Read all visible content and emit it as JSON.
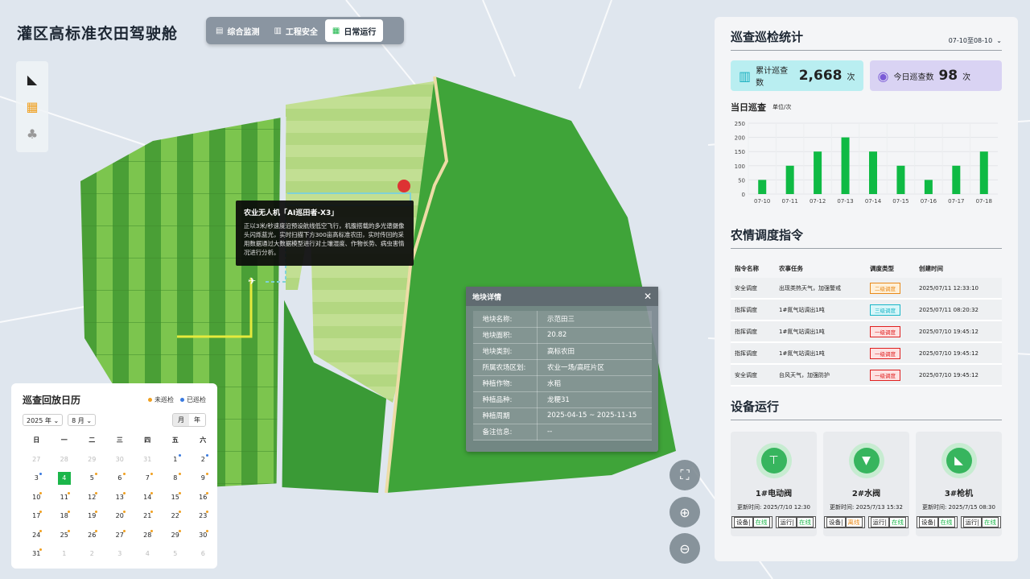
{
  "header": {
    "title": "灌区高标准农田驾驶舱"
  },
  "nav": {
    "tabs": [
      {
        "label": "综合监测",
        "icon": "monitor-icon"
      },
      {
        "label": "工程安全",
        "icon": "building-icon"
      },
      {
        "label": "日常运行",
        "icon": "operation-icon",
        "active": true
      }
    ]
  },
  "toolbox": {
    "icons": [
      "camera-icon",
      "field-icon",
      "crop-icon"
    ]
  },
  "popup": {
    "title": "农业无人机「AI巡田者-X3」",
    "text": "正以3米/秒速度沿预设航线低空飞行，机腹搭载的多光谱摄像头闪烁蓝光，实时扫描下方300亩高标准农田，实时传回的采用数据通过大数据模型进行对土壤湿度、作物长势、病虫害情况进行分析。"
  },
  "plot": {
    "title": "地块详情",
    "rows": [
      {
        "k": "地块名称:",
        "v": "示范田三"
      },
      {
        "k": "地块面积:",
        "v": "20.82"
      },
      {
        "k": "地块类别:",
        "v": "高标农田"
      },
      {
        "k": "所属农场区划:",
        "v": "农业一场/高旺片区"
      },
      {
        "k": "种植作物:",
        "v": "水稻"
      },
      {
        "k": "种植品种:",
        "v": "龙粳31"
      },
      {
        "k": "种植周期",
        "v": "2025-04-15 ~ 2025-11-15"
      },
      {
        "k": "备注信息:",
        "v": "--"
      }
    ]
  },
  "calendar": {
    "title": "巡查回放日历",
    "legend": {
      "no": "未巡检",
      "yes": "已巡检"
    },
    "year": "2025",
    "year_unit": "年",
    "month": "8",
    "month_unit": "月",
    "mode": [
      "月",
      "年"
    ],
    "weekdays": [
      "日",
      "一",
      "二",
      "三",
      "四",
      "五",
      "六"
    ],
    "days": [
      {
        "d": "27",
        "o": true
      },
      {
        "d": "28",
        "o": true
      },
      {
        "d": "29",
        "o": true
      },
      {
        "d": "30",
        "o": true
      },
      {
        "d": "31",
        "o": true
      },
      {
        "d": "1",
        "m": "b"
      },
      {
        "d": "2",
        "m": "b"
      },
      {
        "d": "3",
        "m": "b"
      },
      {
        "d": "4",
        "today": true
      },
      {
        "d": "5",
        "m": "o"
      },
      {
        "d": "6",
        "m": "o"
      },
      {
        "d": "7",
        "m": "o"
      },
      {
        "d": "8",
        "m": "o"
      },
      {
        "d": "9",
        "m": "o"
      },
      {
        "d": "10",
        "m": "o"
      },
      {
        "d": "11",
        "m": "o"
      },
      {
        "d": "12",
        "m": "o"
      },
      {
        "d": "13",
        "m": "o"
      },
      {
        "d": "14",
        "m": "o"
      },
      {
        "d": "15",
        "m": "o"
      },
      {
        "d": "16",
        "m": "o"
      },
      {
        "d": "17",
        "m": "o"
      },
      {
        "d": "18",
        "m": "o"
      },
      {
        "d": "19",
        "m": "o"
      },
      {
        "d": "20",
        "m": "o"
      },
      {
        "d": "21",
        "m": "o"
      },
      {
        "d": "22",
        "m": "o"
      },
      {
        "d": "23",
        "m": "o"
      },
      {
        "d": "24",
        "m": "o"
      },
      {
        "d": "25",
        "m": "o"
      },
      {
        "d": "26",
        "m": "o"
      },
      {
        "d": "27",
        "m": "o"
      },
      {
        "d": "28",
        "m": "o"
      },
      {
        "d": "29",
        "m": "o"
      },
      {
        "d": "30",
        "m": "o"
      },
      {
        "d": "31",
        "m": "o"
      },
      {
        "d": "1",
        "o": true
      },
      {
        "d": "2",
        "o": true
      },
      {
        "d": "3",
        "o": true
      },
      {
        "d": "4",
        "o": true
      },
      {
        "d": "5",
        "o": true
      },
      {
        "d": "6",
        "o": true
      }
    ]
  },
  "inspection": {
    "title": "巡查巡检统计",
    "range": "07-10至08-10",
    "total_label": "累计巡查数",
    "total": "2,668",
    "today_label": "今日巡查数",
    "today": "98",
    "unit": "次"
  },
  "chart_data": {
    "type": "bar",
    "title": "当日巡查",
    "unit_label": "单位/次",
    "categories": [
      "07-10",
      "07-11",
      "07-12",
      "07-13",
      "07-14",
      "07-15",
      "07-16",
      "07-17",
      "07-18"
    ],
    "values": [
      50,
      100,
      150,
      200,
      150,
      100,
      50,
      100,
      150
    ],
    "yticks": [
      "0",
      "50",
      "100",
      "150",
      "200",
      "250"
    ],
    "ylim": [
      0,
      250
    ],
    "color": "#0fba44"
  },
  "dispatch": {
    "title": "农情调度指令",
    "headers": [
      "指令名称",
      "农事任务",
      "调度类型",
      "创建时间"
    ],
    "rows": [
      {
        "name": "安全调度",
        "task": "出现类热天气，加强警戒",
        "type": "二级调度",
        "level": "l2",
        "time": "2025/07/11 12:33:10"
      },
      {
        "name": "指挥调度",
        "task": "1#氮气站调出1吨",
        "type": "三级调度",
        "level": "l3",
        "time": "2025/07/11 08:20:32"
      },
      {
        "name": "指挥调度",
        "task": "1#氮气站调出1吨",
        "type": "一级调度",
        "level": "l1",
        "time": "2025/07/10 19:45:12"
      },
      {
        "name": "指挥调度",
        "task": "1#氮气站调出1吨",
        "type": "一级调度",
        "level": "l1",
        "time": "2025/07/10 19:45:12"
      },
      {
        "name": "安全调度",
        "task": "台风天气，加强防护",
        "type": "一级调度",
        "level": "l1",
        "time": "2025/07/10 19:45:12"
      }
    ]
  },
  "devices": {
    "title": "设备运行",
    "time_label": "更新时间:",
    "items": [
      {
        "name": "1#电动阀",
        "icon": "valve-icon",
        "time": "2025/7/10 12:30",
        "dev_label": "设备|",
        "dev_status": "在线",
        "dev_color": "#1bb64a",
        "run_label": "运行|",
        "run_status": "在线",
        "run_color": "#1bb64a"
      },
      {
        "name": "2#水阀",
        "icon": "water-valve-icon",
        "time": "2025/7/13 15:32",
        "dev_label": "设备|",
        "dev_status": "离线",
        "dev_color": "#e88a1a",
        "run_label": "运行|",
        "run_status": "在线",
        "run_color": "#1bb64a"
      },
      {
        "name": "3#枪机",
        "icon": "camera-icon",
        "time": "2025/7/15 08:30",
        "dev_label": "设备|",
        "dev_status": "在线",
        "dev_color": "#1bb64a",
        "run_label": "运行|",
        "run_status": "在线",
        "run_color": "#1bb64a"
      }
    ]
  }
}
